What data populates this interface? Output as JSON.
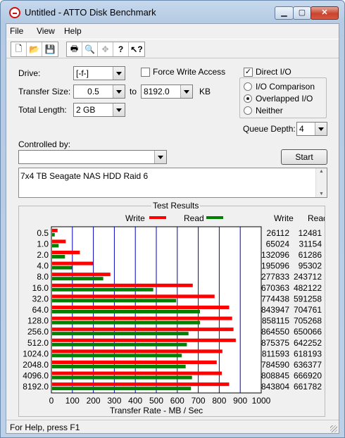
{
  "window": {
    "title": "Untitled - ATTO Disk Benchmark"
  },
  "menu": [
    "File",
    "View",
    "Help"
  ],
  "toolbar_icons": [
    "new-file-icon",
    "open-folder-icon",
    "save-icon",
    "print-icon",
    "print-preview-icon",
    "move-icon",
    "help-icon",
    "context-help-icon"
  ],
  "form": {
    "drive_label": "Drive:",
    "drive_value": "[-f-]",
    "force_write_label": "Force Write Access",
    "force_write_checked": false,
    "direct_io_label": "Direct I/O",
    "direct_io_checked": true,
    "transfer_size_label": "Transfer Size:",
    "transfer_from": "0.5",
    "to_label": "to",
    "transfer_to": "8192.0",
    "kb_label": "KB",
    "total_length_label": "Total Length:",
    "total_length_value": "2 GB",
    "io_comparison_label": "I/O Comparison",
    "overlapped_io_label": "Overlapped I/O",
    "neither_label": "Neither",
    "selected_mode": "Overlapped I/O",
    "queue_depth_label": "Queue Depth:",
    "queue_depth_value": "4",
    "controlled_by_label": "Controlled by:",
    "controlled_by_value": "",
    "start_button": "Start",
    "description": "7x4 TB Seagate NAS HDD Raid 6"
  },
  "results": {
    "title": "Test Results",
    "write_legend": "Write",
    "read_legend": "Read",
    "write_col": "Write",
    "read_col": "Read",
    "write_color": "#ff0000",
    "read_color": "#008000"
  },
  "chart_data": {
    "type": "bar",
    "orientation": "horizontal",
    "xlabel": "Transfer Rate - MB / Sec",
    "xlim": [
      0,
      1000
    ],
    "xticks": [
      0,
      100,
      200,
      300,
      400,
      500,
      600,
      700,
      800,
      900,
      1000
    ],
    "categories": [
      "0.5",
      "1.0",
      "2.0",
      "4.0",
      "8.0",
      "16.0",
      "32.0",
      "64.0",
      "128.0",
      "256.0",
      "512.0",
      "1024.0",
      "2048.0",
      "4096.0",
      "8192.0"
    ],
    "series": [
      {
        "name": "Write",
        "color": "#ff0000",
        "values": [
          26.1,
          65.0,
          132.1,
          195.1,
          277.8,
          670.4,
          774.4,
          843.9,
          858.1,
          864.6,
          875.4,
          811.6,
          784.6,
          808.8,
          843.8
        ],
        "table": [
          "26112",
          "65024",
          "132096",
          "195096",
          "277833",
          "670363",
          "774438",
          "843947",
          "858115",
          "864550",
          "875375",
          "811593",
          "784590",
          "808845",
          "843804"
        ]
      },
      {
        "name": "Read",
        "color": "#008000",
        "values": [
          12.5,
          31.2,
          61.3,
          95.3,
          243.7,
          482.1,
          591.3,
          704.8,
          705.3,
          650.1,
          642.3,
          618.2,
          636.4,
          666.9,
          661.8
        ],
        "table": [
          "12481",
          "31154",
          "61286",
          "95302",
          "243712",
          "482122",
          "591258",
          "704761",
          "705268",
          "650066",
          "642252",
          "618193",
          "636377",
          "666920",
          "661782"
        ]
      }
    ]
  },
  "status": {
    "text": "For Help, press F1"
  }
}
